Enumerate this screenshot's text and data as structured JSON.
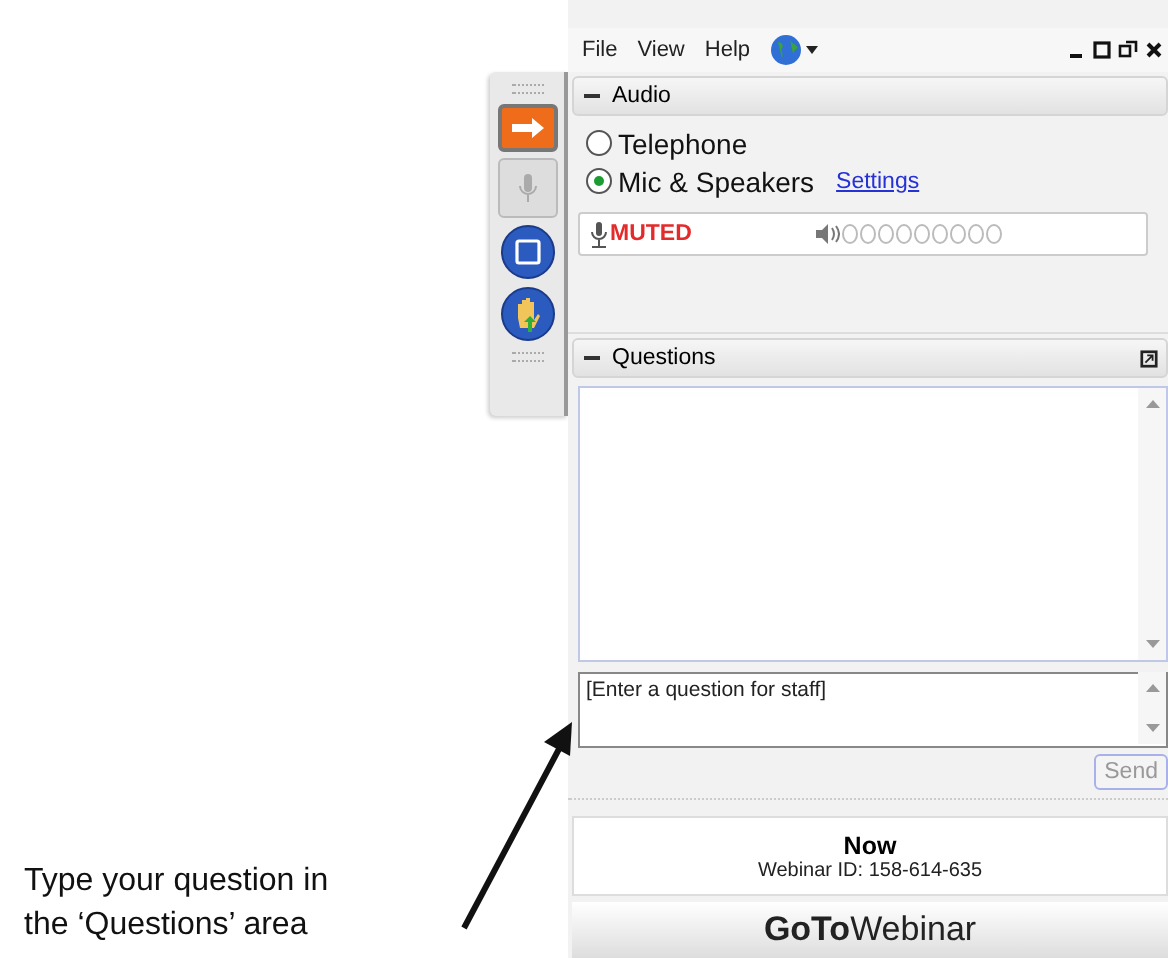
{
  "menu": [
    "File",
    "View",
    "Help"
  ],
  "toolbar": [
    {
      "kind": "arrow"
    },
    {
      "kind": "mic"
    },
    {
      "kind": "screen"
    },
    {
      "kind": "hand"
    }
  ],
  "audio": {
    "title": "Audio",
    "options": [
      {
        "label": "Telephone",
        "selected": false
      },
      {
        "label": "Mic & Speakers",
        "selected": true
      }
    ],
    "settings_link": "Settings",
    "mic_status": "MUTED"
  },
  "questions": {
    "title": "Questions",
    "placeholder": "[Enter a question for staff]",
    "send": {
      "label": "Send",
      "disabled": true
    }
  },
  "footer": {
    "time": "Now",
    "webinar_id": "Webinar ID: 158-614-635",
    "logo": "**GoTo**Webinar"
  },
  "annotation": "Type your question in the ‘Questions’ area"
}
